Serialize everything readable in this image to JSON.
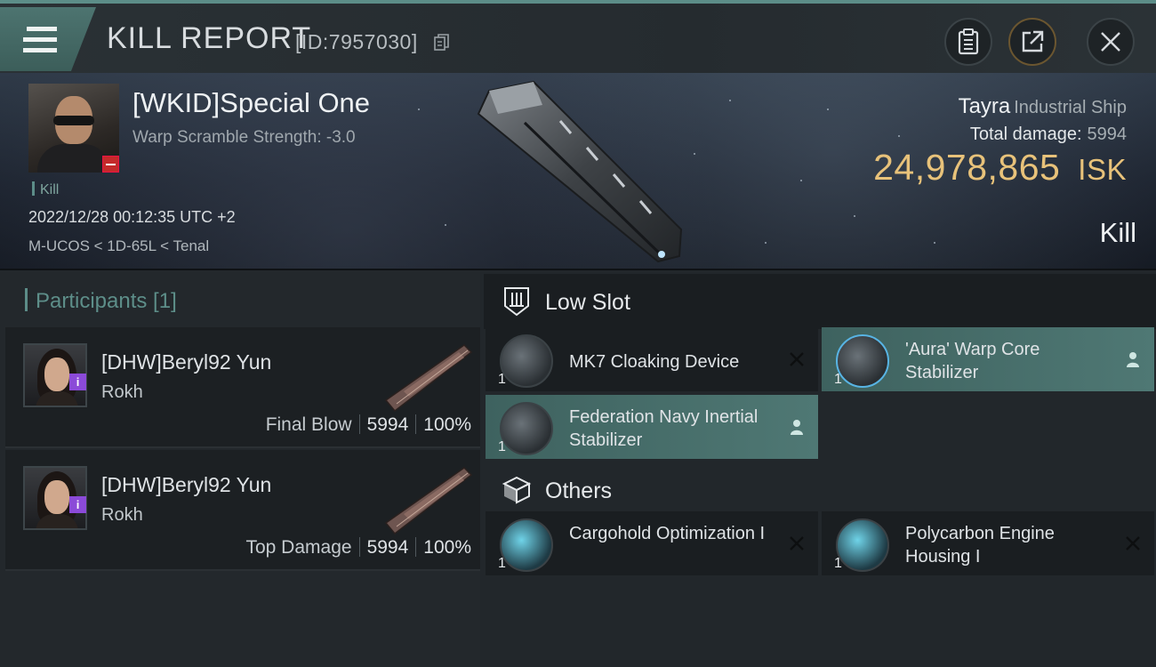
{
  "header": {
    "title": "KILL REPORT",
    "report_id": "[ID:7957030]"
  },
  "victim": {
    "name": "[WKID]Special One",
    "scramble": "Warp Scramble Strength: -3.0",
    "tag": "Kill",
    "time": "2022/12/28 00:12:35 UTC +2",
    "location": "M-UCOS < 1D-65L < Tenal"
  },
  "ship": {
    "name": "Tayra",
    "class": "Industrial Ship",
    "damage_label": "Total damage:",
    "damage_value": "5994",
    "isk_value": "24,978,865",
    "isk_unit": "ISK",
    "result": "Kill"
  },
  "participants": {
    "title": "Participants [1]",
    "rows": [
      {
        "name": "[DHW]Beryl92 Yun",
        "ship": "Rokh",
        "role": "Final Blow",
        "damage": "5994",
        "percent": "100%"
      },
      {
        "name": "[DHW]Beryl92 Yun",
        "ship": "Rokh",
        "role": "Top Damage",
        "damage": "5994",
        "percent": "100%"
      }
    ]
  },
  "fitting": {
    "low_slot_title": "Low Slot",
    "others_title": "Others",
    "items": [
      {
        "name": "MK7 Cloaking Device",
        "qty": "1",
        "status": "destroyed"
      },
      {
        "name": "'Aura' Warp Core Stabilizer",
        "qty": "1",
        "status": "dropped"
      },
      {
        "name": "Federation Navy Inertial Stabilizer",
        "qty": "1",
        "status": "dropped"
      },
      {
        "name": "Cargohold Optimization I",
        "qty": "1",
        "status": "destroyed"
      },
      {
        "name": "Polycarbon Engine Housing I",
        "qty": "1",
        "status": "destroyed"
      }
    ]
  },
  "colors": {
    "accent": "#5c8d88",
    "isk": "#e8c27a",
    "highlight": "#4f7874",
    "badge_red": "#c42a2a",
    "badge_purple": "#8b4ad8"
  }
}
